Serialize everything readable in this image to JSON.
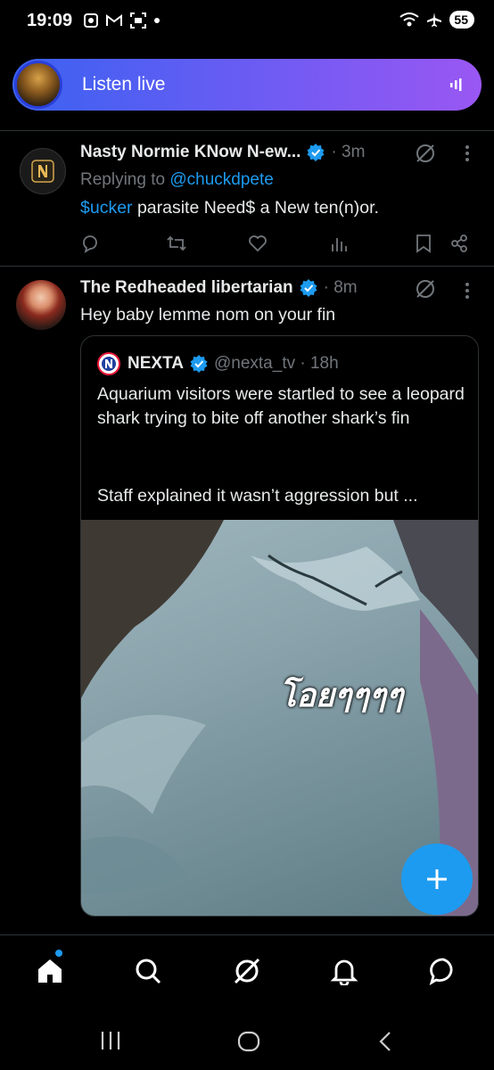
{
  "status_bar": {
    "time": "19:09",
    "battery": "55"
  },
  "spaces_bar": {
    "label": "Listen live"
  },
  "tweets": [
    {
      "name": "Nasty Normie KNow N-ew...",
      "time": "· 3m",
      "replying_prefix": "Replying to ",
      "replying_handle": "@chuckdpete",
      "text_link": "$ucker",
      "text_rest": " parasite Need$ a New ten(n)or."
    },
    {
      "name": "The Redheaded libertarian",
      "time": "· 8m",
      "text": "Hey baby lemme nom on your fin",
      "quote": {
        "name": "NEXTA",
        "handle": "@nexta_tv · 18h",
        "text": "Aquarium visitors were startled to see a leopard shark trying to bite off another shark’s fin",
        "text2": "Staff explained it wasn’t aggression but ...",
        "media_caption": "โอยๆๆๆๆ"
      }
    }
  ],
  "colors": {
    "accent": "#1d9bf0",
    "background": "#000000",
    "divider": "#2f3336",
    "secondary_text": "#71767b"
  },
  "icons": {
    "bottom_nav": [
      "home-icon",
      "search-icon",
      "grok-icon",
      "notifications-icon",
      "messages-icon"
    ],
    "tweet_actions": [
      "reply-icon",
      "retweet-icon",
      "like-icon",
      "views-icon",
      "bookmark-icon",
      "share-icon"
    ]
  }
}
